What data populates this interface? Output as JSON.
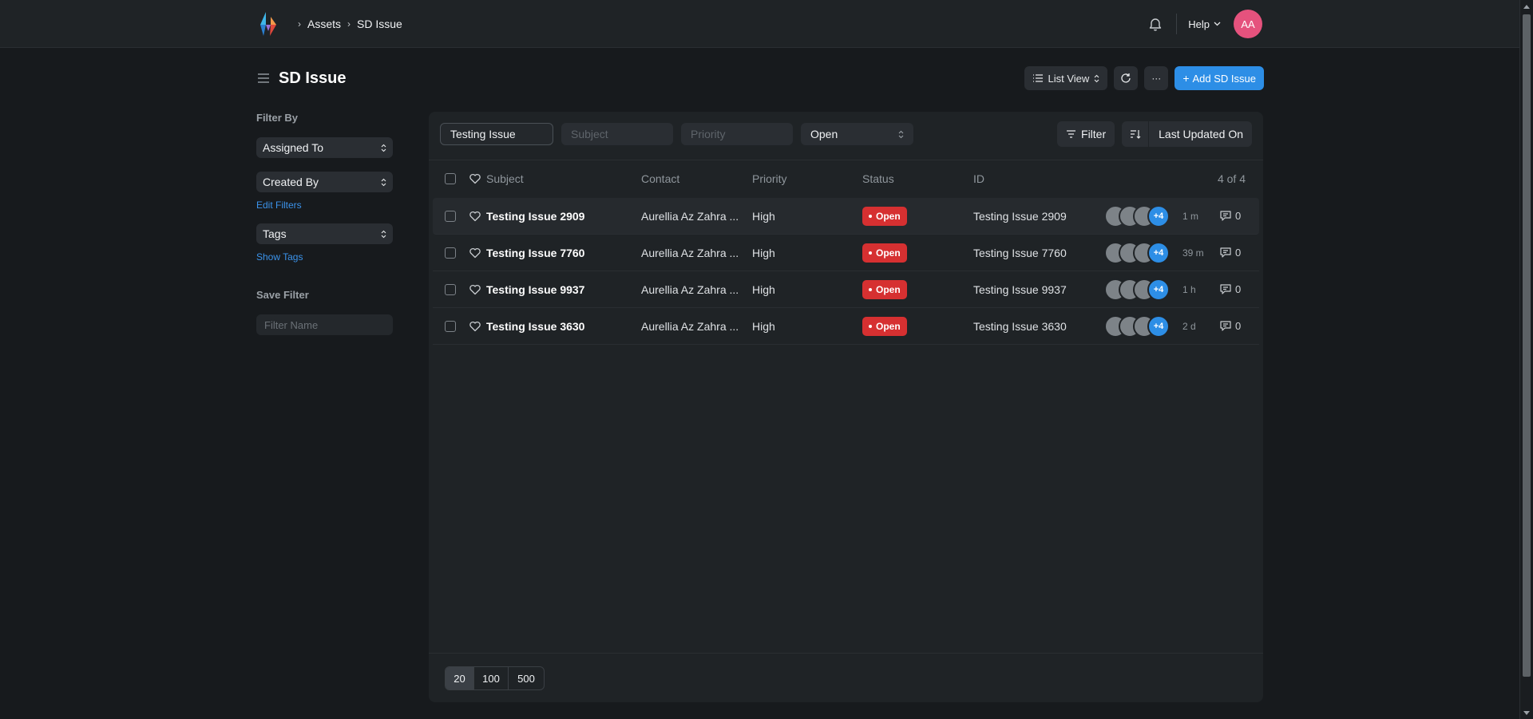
{
  "nav": {
    "breadcrumbs": [
      "Assets",
      "SD Issue"
    ],
    "help_label": "Help",
    "avatar_initials": "AA",
    "avatar_color": "#e5527d"
  },
  "page": {
    "title": "SD Issue",
    "list_view_label": "List View",
    "add_button_label": "Add SD Issue",
    "more_label": "···"
  },
  "sidebar": {
    "filter_by_heading": "Filter By",
    "assigned_to": "Assigned To",
    "created_by": "Created By",
    "edit_filters": "Edit Filters",
    "tags": "Tags",
    "show_tags": "Show Tags",
    "save_filter_heading": "Save Filter",
    "filter_name_placeholder": "Filter Name"
  },
  "filters": {
    "search_value": "Testing Issue",
    "subject_placeholder": "Subject",
    "priority_placeholder": "Priority",
    "status_value": "Open",
    "filter_label": "Filter",
    "sort_label": "Last Updated On"
  },
  "table": {
    "headers": {
      "subject": "Subject",
      "contact": "Contact",
      "priority": "Priority",
      "status": "Status",
      "id": "ID",
      "count": "4 of 4"
    },
    "rows": [
      {
        "subject": "Testing Issue 2909",
        "contact": "Aurellia Az Zahra ...",
        "priority": "High",
        "status": "Open",
        "id": "Testing Issue 2909",
        "more": "+4",
        "time": "1 m",
        "comments": "0"
      },
      {
        "subject": "Testing Issue 7760",
        "contact": "Aurellia Az Zahra ...",
        "priority": "High",
        "status": "Open",
        "id": "Testing Issue 7760",
        "more": "+4",
        "time": "39 m",
        "comments": "0"
      },
      {
        "subject": "Testing Issue 9937",
        "contact": "Aurellia Az Zahra ...",
        "priority": "High",
        "status": "Open",
        "id": "Testing Issue 9937",
        "more": "+4",
        "time": "1 h",
        "comments": "0"
      },
      {
        "subject": "Testing Issue 3630",
        "contact": "Aurellia Az Zahra ...",
        "priority": "High",
        "status": "Open",
        "id": "Testing Issue 3630",
        "more": "+4",
        "time": "2 d",
        "comments": "0"
      }
    ]
  },
  "pager": {
    "sizes": [
      "20",
      "100",
      "500"
    ],
    "active": "20"
  },
  "colors": {
    "accent": "#2d8ee6",
    "status_open": "#d63031",
    "background": "#171a1d",
    "panel": "#1f2326"
  }
}
